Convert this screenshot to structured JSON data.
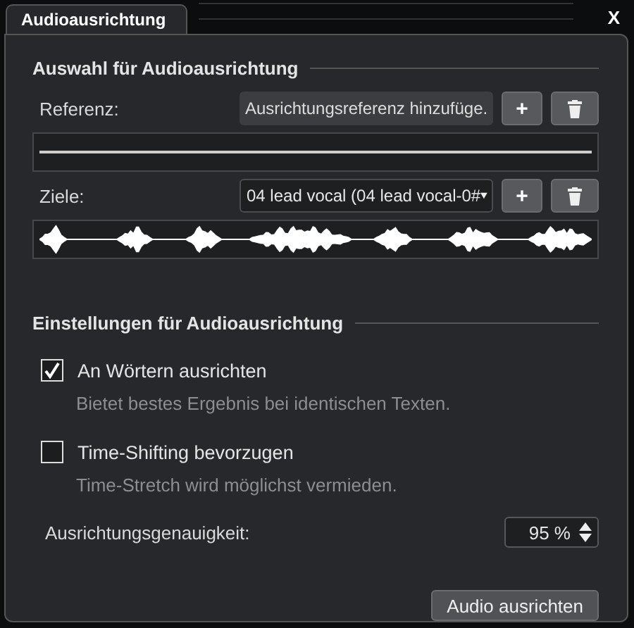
{
  "tabs": [
    {
      "label": "Audioausrichtung",
      "selected": true
    }
  ],
  "close_button": "X",
  "selection": {
    "heading": "Auswahl für Audioausrichtung",
    "reference": {
      "label": "Referenz:",
      "field_value": "Ausrichtungsreferenz hinzufüge.",
      "add_button": "+"
    },
    "targets": {
      "label": "Ziele:",
      "dropdown_value": "04 lead vocal (04 lead vocal-0#",
      "add_button": "+"
    }
  },
  "settings": {
    "heading": "Einstellungen für Audioausrichtung",
    "options": [
      {
        "label": "An Wörtern ausrichten",
        "description": "Bietet bestes Ergebnis bei identischen Texten.",
        "checked": true
      },
      {
        "label": "Time-Shifting bevorzugen",
        "description": "Time-Stretch wird möglichst vermieden.",
        "checked": false
      }
    ],
    "accuracy": {
      "label": "Ausrichtungsgenauigkeit:",
      "value": "95 %"
    }
  },
  "action_button": "Audio ausrichten"
}
